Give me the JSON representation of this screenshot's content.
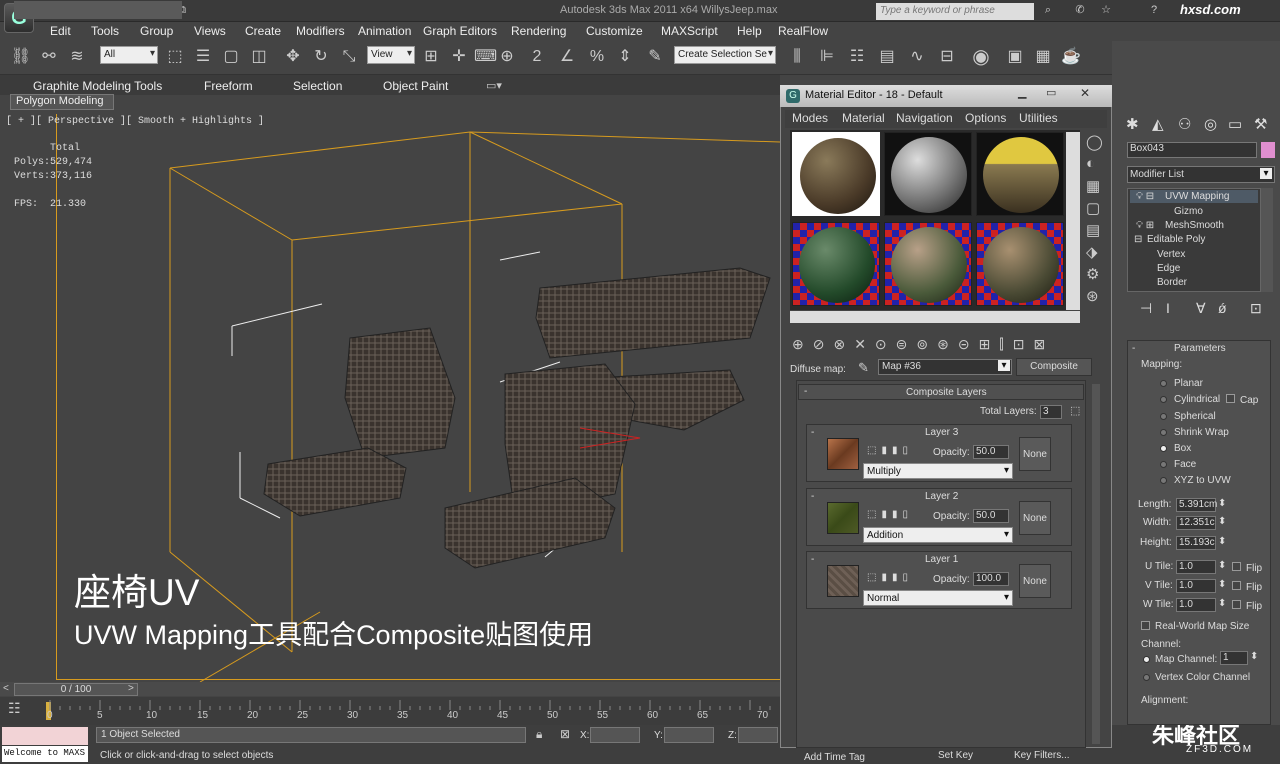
{
  "window": {
    "title": "Autodesk 3ds Max  2011 x64     WillysJeep.max",
    "search_placeholder": "Type a keyword or phrase",
    "app_logo": "3ds-max-logo"
  },
  "watermark": {
    "top": "hxsd.com",
    "bottom": "朱峰社区",
    "bottom_url": "ZF3D.COM"
  },
  "menu": [
    "Edit",
    "Tools",
    "Group",
    "Views",
    "Create",
    "Modifiers",
    "Animation",
    "Graph Editors",
    "Rendering",
    "Customize",
    "MAXScript",
    "Help",
    "RealFlow"
  ],
  "toolbar": {
    "filter_value": "All",
    "refcoord_value": "View",
    "selection_set_placeholder": "Create Selection Se"
  },
  "ribbon": {
    "tabs": [
      "Graphite Modeling Tools",
      "Freeform",
      "Selection",
      "Object Paint"
    ],
    "active_tab": "Graphite Modeling Tools",
    "panel": "Polygon Modeling"
  },
  "viewport": {
    "label": "[ + ][ Perspective ][ Smooth + Highlights ]",
    "stats": {
      "total": "Total",
      "polys_label": "Polys:",
      "polys": "529,474",
      "verts_label": "Verts:",
      "verts": "373,116",
      "fps_label": "FPS:",
      "fps": "21.330"
    },
    "caption_title": "座椅UV",
    "caption_sub": "UVW Mapping工具配合Composite贴图使用"
  },
  "timeline": {
    "position": "0 / 100",
    "ticks": [
      "0",
      "5",
      "10",
      "15",
      "20",
      "25",
      "30",
      "35",
      "40",
      "45",
      "50",
      "55",
      "60",
      "65",
      "70"
    ]
  },
  "status": {
    "welcome": "Welcome to MAXS",
    "selected": "1 Object Selected",
    "prompt": "Click or click-and-drag to select objects",
    "x_label": "X:",
    "y_label": "Y:",
    "z_label": "Z:",
    "add_time_tag": "Add Time Tag",
    "set_key": "Set Key",
    "key_filters": "Key Filters..."
  },
  "material_editor": {
    "title": "Material Editor - 18 - Default",
    "menu": [
      "Modes",
      "Material",
      "Navigation",
      "Options",
      "Utilities"
    ],
    "diffuse_label": "Diffuse map:",
    "map_name": "Map #36",
    "map_type": "Composite",
    "composite_header": "Composite Layers",
    "total_layers_label": "Total Layers:",
    "total_layers": "3",
    "opacity_label": "Opacity:",
    "none_label": "None",
    "layers": [
      {
        "name": "Layer 3",
        "opacity": "50.0",
        "blend": "Multiply",
        "color": "#a0643a"
      },
      {
        "name": "Layer 2",
        "opacity": "50.0",
        "blend": "Addition",
        "color": "#4b5a26"
      },
      {
        "name": "Layer 1",
        "opacity": "100.0",
        "blend": "Normal",
        "color": "#5a4e44"
      }
    ]
  },
  "command_panel": {
    "object_name": "Box043",
    "object_color": "#e08fd0",
    "modifier_list": "Modifier List",
    "stack": [
      "UVW Mapping",
      "Gizmo",
      "MeshSmooth",
      "Editable Poly",
      "Vertex",
      "Edge",
      "Border"
    ],
    "parameters_header": "Parameters",
    "mapping_label": "Mapping:",
    "mapping_options": [
      "Planar",
      "Cylindrical",
      "Spherical",
      "Shrink Wrap",
      "Box",
      "Face",
      "XYZ to UVW"
    ],
    "mapping_selected": "Box",
    "cap_label": "Cap",
    "length_label": "Length:",
    "length": "5.391cm",
    "width_label": "Width:",
    "width": "12.351c",
    "height_label": "Height:",
    "height": "15.193c",
    "utile_label": "U Tile:",
    "utile": "1.0",
    "vtile_label": "V Tile:",
    "vtile": "1.0",
    "wtile_label": "W Tile:",
    "wtile": "1.0",
    "flip_label": "Flip",
    "realworld_label": "Real-World Map Size",
    "channel_label": "Channel:",
    "map_channel_label": "Map Channel:",
    "map_channel": "1",
    "vertex_color_label": "Vertex Color Channel",
    "alignment_label": "Alignment:"
  }
}
